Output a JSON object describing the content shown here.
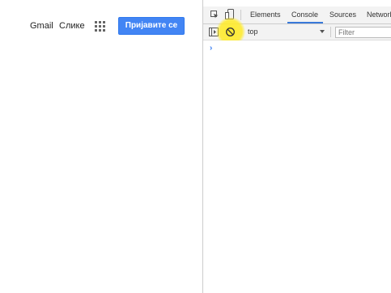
{
  "google": {
    "gmail_link": "Gmail",
    "images_link": "Слике",
    "apps_icon": "apps-grid-icon",
    "signin_label": "Пријавите се",
    "signin_color": "#4285f4"
  },
  "devtools": {
    "icons": {
      "inspect": "inspect-element-icon",
      "device": "device-toolbar-icon",
      "sidebar": "console-sidebar-icon",
      "clear": "clear-console-icon"
    },
    "tabs": [
      {
        "label": "Elements",
        "active": false
      },
      {
        "label": "Console",
        "active": true
      },
      {
        "label": "Sources",
        "active": false
      },
      {
        "label": "Network",
        "active": false
      }
    ],
    "toolbar": {
      "context": "top",
      "filter_placeholder": "Filter"
    },
    "console": {
      "prompt": "›"
    },
    "accent_color": "#3879d9",
    "highlight_color": "#ffeb28"
  }
}
